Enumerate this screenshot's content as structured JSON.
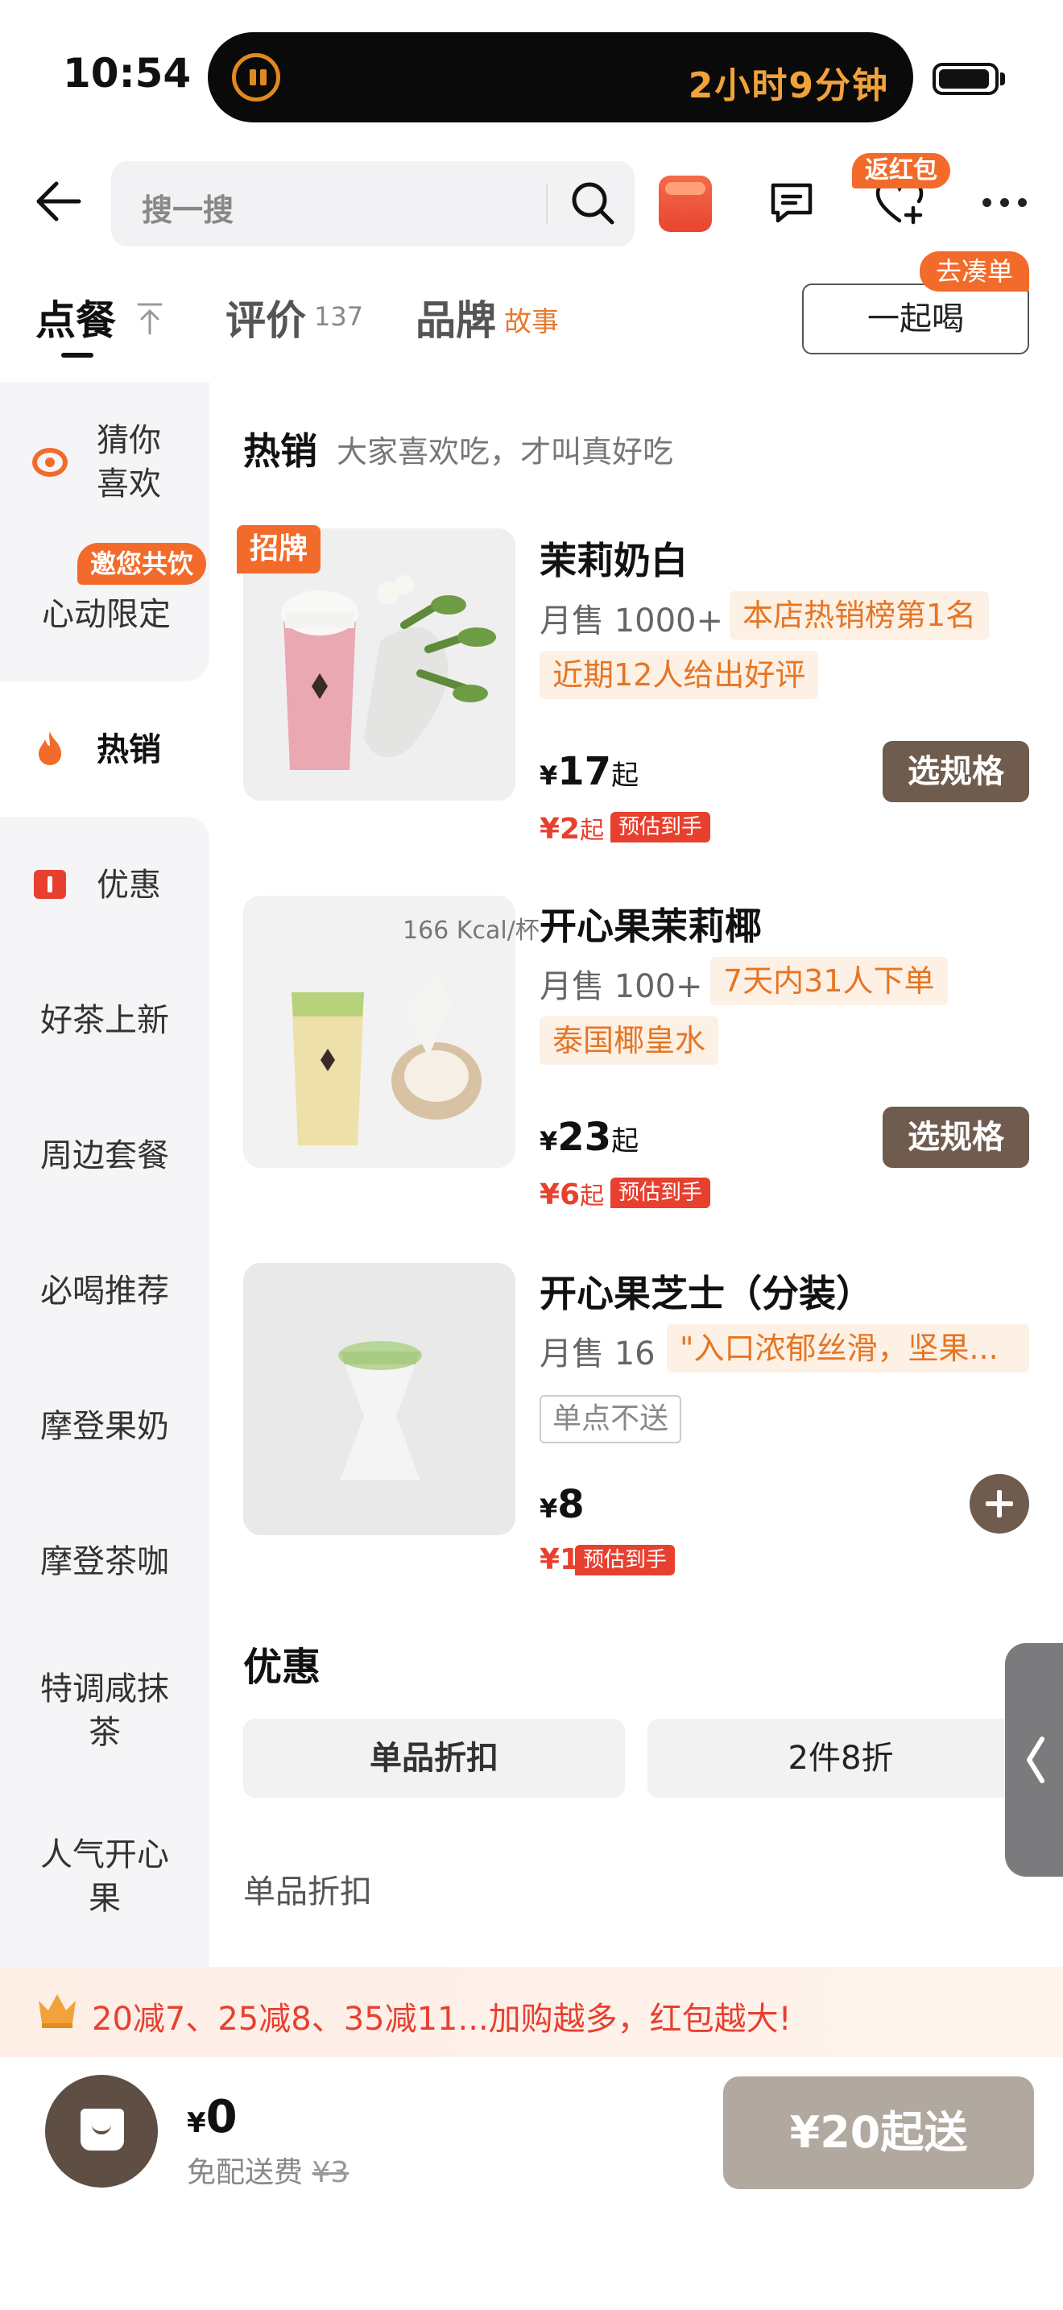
{
  "status_bar": {
    "time": "10:54",
    "island_text": "2小时9分钟"
  },
  "search": {
    "placeholder": "搜一搜"
  },
  "header": {
    "fav_badge": "返红包"
  },
  "tabs": {
    "order": "点餐",
    "review": "评价",
    "review_count": "137",
    "brand": "品牌",
    "brand_sub": "故事",
    "together_label": "一起喝",
    "together_badge": "去凑单"
  },
  "sidebar": {
    "guess_line1": "猜你",
    "guess_line2": "喜欢",
    "invite_badge": "邀您共饮",
    "limited": "心动限定",
    "hot": "热销",
    "discount": "优惠",
    "new_tea": "好茶上新",
    "merch": "周边套餐",
    "must_drink": "必喝推荐",
    "modern_milk": "摩登果奶",
    "modern_tea": "摩登茶咖",
    "matcha_line1": "特调咸抹",
    "matcha_line2": "茶",
    "pistachio_line1": "人气开心",
    "pistachio_line2": "果"
  },
  "section": {
    "title": "热销",
    "subtitle": "大家喜欢吃，才叫真好吃"
  },
  "products": [
    {
      "badge": "招牌",
      "name": "茉莉奶白",
      "sales": "月售 1000+",
      "tag1": "本店热销榜第1名",
      "tag2": "近期12人给出好评",
      "currency": "¥",
      "price": "17",
      "price_suffix": "起",
      "est_price": "¥2",
      "est_suffix": "起",
      "est_tag": "预估到手",
      "action": "选规格"
    },
    {
      "name": "开心果茉莉椰",
      "sales": "月售 100+",
      "tag1": "7天内31人下单",
      "tag2": "泰国椰皇水",
      "currency": "¥",
      "price": "23",
      "price_suffix": "起",
      "est_price": "¥6",
      "est_suffix": "起",
      "est_tag": "预估到手",
      "action": "选规格",
      "image_text": "166 Kcal/杯"
    },
    {
      "name": "开心果芝士（分装）",
      "sales": "月售 16",
      "tag1": "\"入口浓郁丝滑，坚果...",
      "tag2": "单点不送",
      "currency": "¥",
      "price": "8",
      "est_price": "¥1",
      "est_tag": "预估到手"
    }
  ],
  "discount": {
    "title": "优惠",
    "tab_single": "单品折扣",
    "tab_two": "2件8折",
    "sub_title": "单品折扣"
  },
  "promo": {
    "text": "20减7、25减8、35减11...加购越多，红包越大!"
  },
  "cart": {
    "currency": "¥",
    "total": "0",
    "delivery_label": "免配送费",
    "delivery_original": "¥3",
    "checkout": "¥20起送"
  },
  "colors": {
    "accent": "#f26b2a",
    "price_red": "#e8402f",
    "button_brown": "#6f5c4f"
  }
}
